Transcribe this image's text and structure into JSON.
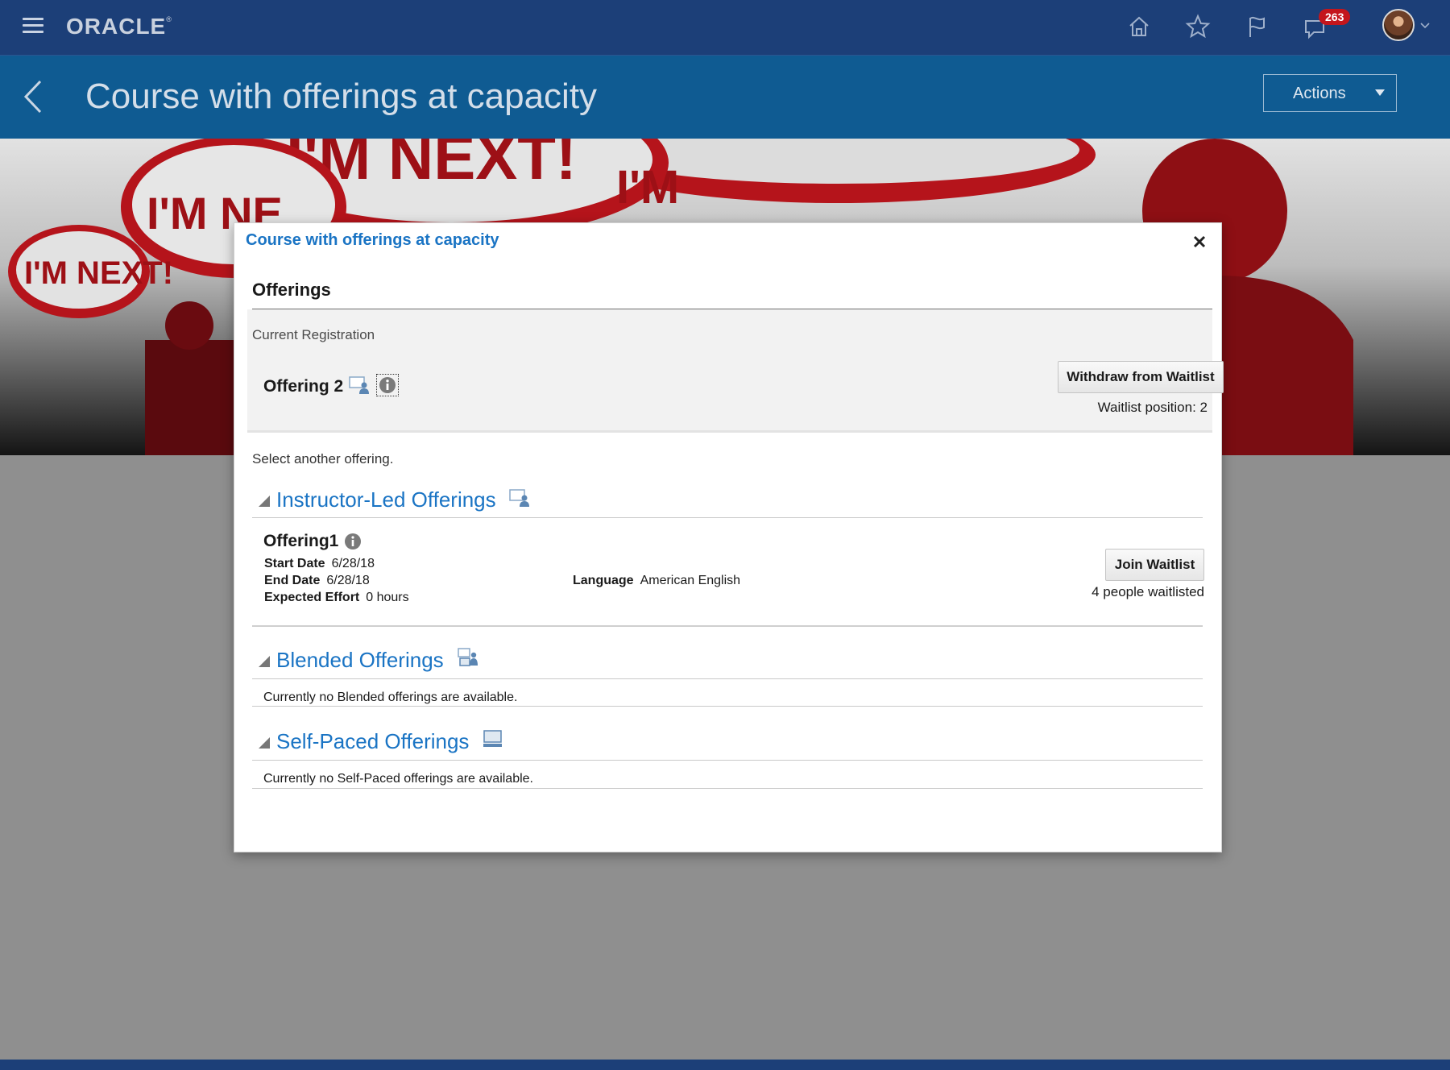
{
  "header": {
    "logo": "ORACLE",
    "logo_mark": "®",
    "notifications_count": "263"
  },
  "titlebar": {
    "title": "Course with offerings at capacity",
    "actions_label": "Actions"
  },
  "banner": {
    "text_a": "I'M NEXT!",
    "text_b": "I'M NE",
    "text_c": "I'M NEXT!",
    "text_d": "I'M",
    "colors": {
      "speech_red": "#b5141b"
    }
  },
  "dialog": {
    "title": "Course with offerings at capacity",
    "section_heading": "Offerings",
    "current_registration": {
      "label": "Current Registration",
      "offering_name": "Offering 2",
      "withdraw_label": "Withdraw from Waitlist",
      "waitlist_position": "Waitlist position: 2"
    },
    "select_another": "Select another offering.",
    "groups": [
      {
        "title": "Instructor-Led Offerings",
        "icon": "instructor-led-icon"
      },
      {
        "title": "Blended Offerings",
        "icon": "blended-icon"
      },
      {
        "title": "Self-Paced Offerings",
        "icon": "self-paced-icon"
      }
    ],
    "offering1": {
      "name": "Offering1",
      "start_label": "Start Date",
      "start_value": "6/28/18",
      "end_label": "End Date",
      "end_value": "6/28/18",
      "effort_label": "Expected Effort",
      "effort_value": "0 hours",
      "language_label": "Language",
      "language_value": "American English",
      "join_label": "Join Waitlist",
      "waitlisted": "4 people waitlisted"
    },
    "blended_empty": "Currently no Blended offerings are available.",
    "selfpaced_empty": "Currently no Self-Paced offerings are available."
  },
  "colors": {
    "global_header": "#1c3f78",
    "title_bar": "#0f5b92",
    "link_blue": "#1a74c4",
    "overlay_grey": "#8f8f8f",
    "notification_badge": "#c4161c"
  }
}
